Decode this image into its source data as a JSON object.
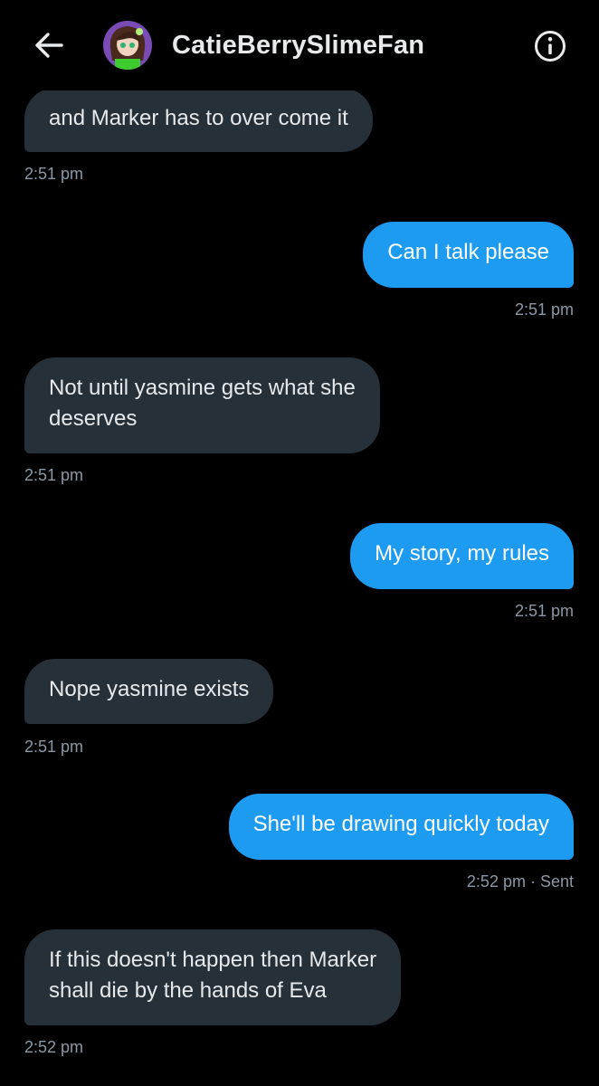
{
  "header": {
    "title": "CatieBerrySlimeFan",
    "back_icon": "arrow-left-icon",
    "info_icon": "info-icon"
  },
  "colors": {
    "background": "#000000",
    "incoming_bubble": "#263038",
    "outgoing_bubble": "#1d9bf0",
    "timestamp": "#8b98a5",
    "text": "#e7e9ea"
  },
  "messages": [
    {
      "direction": "in",
      "lines": [
        "and Marker has to over come it"
      ],
      "time": "2:51 pm"
    },
    {
      "direction": "out",
      "lines": [
        "Can I talk please"
      ],
      "time": "2:51 pm"
    },
    {
      "direction": "in",
      "lines": [
        "Not until yasmine gets what she",
        "deserves"
      ],
      "time": "2:51 pm"
    },
    {
      "direction": "out",
      "lines": [
        "My story, my rules"
      ],
      "time": "2:51 pm"
    },
    {
      "direction": "in",
      "lines": [
        "Nope yasmine exists"
      ],
      "time": "2:51 pm"
    },
    {
      "direction": "out",
      "lines": [
        "She'll be drawing quickly today"
      ],
      "time": "2:52 pm · Sent"
    },
    {
      "direction": "in",
      "lines": [
        "If this doesn't happen then Marker",
        "shall die by the hands of Eva"
      ],
      "time": "2:52 pm"
    }
  ]
}
